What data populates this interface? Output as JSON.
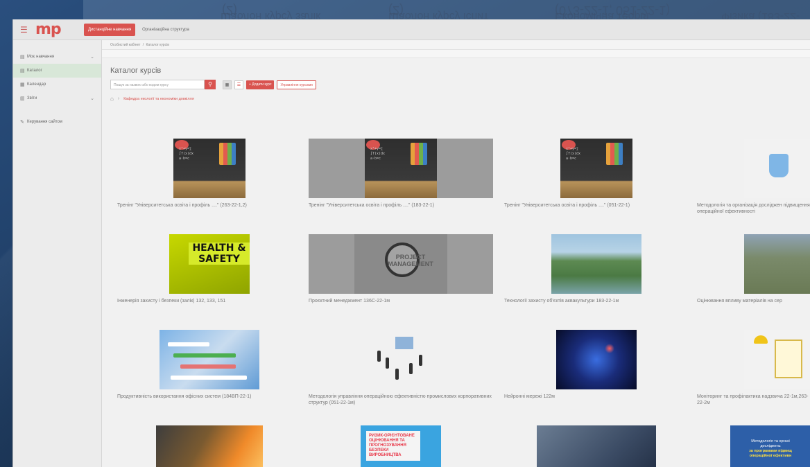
{
  "ghost_titles": [
    "(2)",
    "Шаблон курсу залік",
    "(2)",
    "Шаблон курсу іспит",
    "(073-22-1, 051-22-1)",
    "Економічна теорія",
    "Фізика (183-22-"
  ],
  "topbar": {
    "menu_icon": "hamburger-icon",
    "logo": "mp",
    "tabs": [
      {
        "label": "Дистанційне навчання",
        "active": true
      },
      {
        "label": "Організаційна структура",
        "active": false
      }
    ]
  },
  "sidebar": {
    "items": [
      {
        "icon": "book-icon",
        "label": "Моє навчання",
        "chevron": true,
        "active": false
      },
      {
        "icon": "catalog-icon",
        "label": "Каталог",
        "chevron": false,
        "active": true
      },
      {
        "icon": "calendar-icon",
        "label": "Календар",
        "chevron": false,
        "active": false
      },
      {
        "icon": "reports-icon",
        "label": "Звіти",
        "chevron": true,
        "active": false
      },
      {
        "icon": "wrench-icon",
        "label": "Керування сайтом",
        "chevron": false,
        "active": false
      }
    ]
  },
  "breadcrumb": {
    "home": "Особистий кабінет",
    "separator": "/",
    "current": "Каталог курсів"
  },
  "page": {
    "title": "Каталог курсів",
    "search_placeholder": "Пошук за назвою або кодом курсу",
    "add_course_label": "+ Додати курс",
    "manage_courses_label": "Управління курсами",
    "path_label": "Кафедра екології та економіки довкілля"
  },
  "courses": [
    {
      "title": "Тренінг \"Університетська освіта і профіль ....\" (263-22-1,2)",
      "thumb": "chalkboard",
      "shaded": false
    },
    {
      "title": "Тренінг \"Університетська освіта і профіль ....\" (183-22-1)",
      "thumb": "chalkboard",
      "shaded": true
    },
    {
      "title": "Тренінг \"Університетська освіта і профіль ....\" (051-22-1)",
      "thumb": "chalkboard",
      "shaded": false
    },
    {
      "title": "Методологія та організація досліджен підвищення операційної ефективності",
      "thumb": "science",
      "shaded": false
    },
    {
      "title": "Інженерія захисту і безпеки (залік) 132, 133, 151",
      "thumb": "safety",
      "shaded": false
    },
    {
      "title": "Проєктний менеджмент 136С-22-1м",
      "thumb": "pm",
      "shaded": true
    },
    {
      "title": "Технології захисту об'єктів аквакультури 183-22-1м",
      "thumb": "aqua",
      "shaded": false
    },
    {
      "title": "Оцінювання впливу матеріалів на сер",
      "thumb": "quarry",
      "shaded": false
    },
    {
      "title": "Продуктивність використання офісних систем (184ВП-22-1)",
      "thumb": "office",
      "shaded": false
    },
    {
      "title": "Методологія управління операційною ефективністю промислових корпоративних структур (051-22-1м)",
      "thumb": "people",
      "shaded": false
    },
    {
      "title": "Нейронні мережі 122м",
      "thumb": "brain",
      "shaded": false
    },
    {
      "title": "Моніторинг та профілактика надзвича 22-1м,263-22-2м",
      "thumb": "worker",
      "shaded": false
    },
    {
      "title": "",
      "thumb": "fire",
      "shaded": false
    },
    {
      "title": "",
      "thumb": "risk",
      "shaded": false
    },
    {
      "title": "",
      "thumb": "laptop",
      "shaded": false
    },
    {
      "title": "",
      "thumb": "method",
      "shaded": false
    }
  ],
  "thumb_text": {
    "safety": "HEALTH & SAFETY",
    "pm": "PROJECT MANAGEMENT",
    "risk": "РИЗИК-ОРІЄНТОВАНЕ ОЦІНЮВАННЯ ТА ПРОГНОЗУВАННЯ БЕЗПЕКИ ВИРОБНИЦТВА",
    "method_line1": "Методологія та органі",
    "method_line2": "досліджень",
    "method_line3": "за програмами підвищ",
    "method_line4": "операційної ефективн"
  },
  "colors": {
    "accent": "#d9534f",
    "sidebar_active": "#d8e7d8"
  }
}
